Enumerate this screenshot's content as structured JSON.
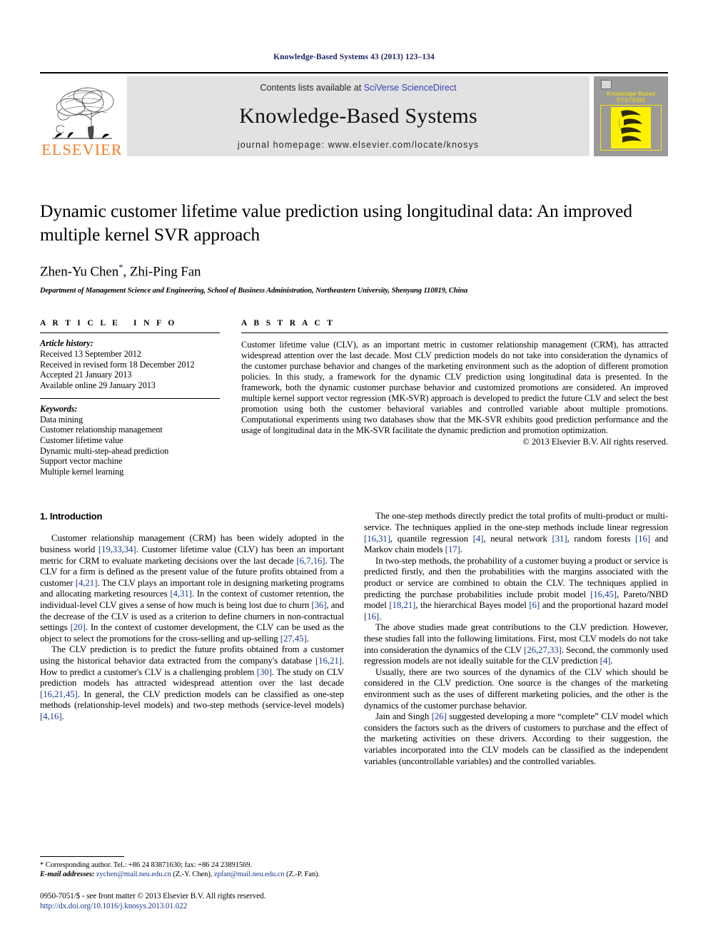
{
  "running_head": "Knowledge-Based Systems 43 (2013) 123–134",
  "masthead": {
    "publisher_name": "ELSEVIER",
    "contents_prefix": "Contents lists available at ",
    "contents_link": "SciVerse ScienceDirect",
    "journal_title": "Knowledge-Based Systems",
    "homepage_line": "journal homepage: www.elsevier.com/locate/knosys",
    "cover": {
      "line1": "Knowledge-Based",
      "line2": "SYSTEMS"
    },
    "link_color": "#3a3fb5"
  },
  "article": {
    "title": "Dynamic customer lifetime value prediction using longitudinal data: An improved multiple kernel SVR approach",
    "authors": "Zhen-Yu Chen",
    "corresponding_marker": "*",
    "authors_rest": ", Zhi-Ping Fan",
    "affiliation": "Department of Management Science and Engineering, School of Business Administration, Northeastern University, Shenyang 110819, China"
  },
  "article_info": {
    "heading": "ARTICLE INFO",
    "history_label": "Article history:",
    "history": [
      "Received 13 September 2012",
      "Received in revised form 18 December 2012",
      "Accepted 21 January 2013",
      "Available online 29 January 2013"
    ],
    "keywords_label": "Keywords:",
    "keywords": [
      "Data mining",
      "Customer relationship management",
      "Customer lifetime value",
      "Dynamic multi-step-ahead prediction",
      "Support vector machine",
      "Multiple kernel learning"
    ]
  },
  "abstract": {
    "heading": "ABSTRACT",
    "text": "Customer lifetime value (CLV), as an important metric in customer relationship management (CRM), has attracted widespread attention over the last decade. Most CLV prediction models do not take into consideration the dynamics of the customer purchase behavior and changes of the marketing environment such as the adoption of different promotion policies. In this study, a framework for the dynamic CLV prediction using longitudinal data is presented. In the framework, both the dynamic customer purchase behavior and customized promotions are considered. An improved multiple kernel support vector regression (MK-SVR) approach is developed to predict the future CLV and select the best promotion using both the customer behavioral variables and controlled variable about multiple promotions. Computational experiments using two databases show that the MK-SVR exhibits good prediction performance and the usage of longitudinal data in the MK-SVR facilitate the dynamic prediction and promotion optimization.",
    "copyright": "© 2013 Elsevier B.V. All rights reserved."
  },
  "body": {
    "section_title": "1. Introduction",
    "left_paragraphs": [
      "Customer relationship management (CRM) has been widely adopted in the business world [19,33,34]. Customer lifetime value (CLV) has been an important metric for CRM to evaluate marketing decisions over the last decade [6,7,16]. The CLV for a firm is defined as the present value of the future profits obtained from a customer [4,21]. The CLV plays an important role in designing marketing programs and allocating marketing resources [4,31]. In the context of customer retention, the individual-level CLV gives a sense of how much is being lost due to churn [36], and the decrease of the CLV is used as a criterion to define churners in non-contractual settings [20]. In the context of customer development, the CLV can be used as the object to select the promotions for the cross-selling and up-selling [27,45].",
      "The CLV prediction is to predict the future profits obtained from a customer using the historical behavior data extracted from the company's database [16,21]. How to predict a customer's CLV is a challenging problem [30]. The study on CLV prediction models has attracted widespread attention over the last decade [16,21,45]. In general, the CLV prediction models can be classified as one-step methods (relationship-level models) and two-step methods (service-level models) [4,16]."
    ],
    "right_paragraphs": [
      "The one-step methods directly predict the total profits of multi-product or multi-service. The techniques applied in the one-step methods include linear regression [16,31], quantile regression [4], neural network [31], random forests [16] and Markov chain models [17].",
      "In two-step methods, the probability of a customer buying a product or service is predicted firstly, and then the probabilities with the margins associated with the product or service are combined to obtain the CLV. The techniques applied in predicting the purchase probabilities include probit model [16,45], Pareto/NBD model [18,21], the hierarchical Bayes model [6] and the proportional hazard model [16].",
      "The above studies made great contributions to the CLV prediction. However, these studies fall into the following limitations. First, most CLV models do not take into consideration the dynamics of the CLV [26,27,33]. Second, the commonly used regression models are not ideally suitable for the CLV prediction [4].",
      "Usually, there are two sources of the dynamics of the CLV which should be considered in the CLV prediction. One source is the changes of the marketing environment such as the uses of different marketing policies, and the other is the dynamics of the customer purchase behavior.",
      "Jain and Singh [26] suggested developing a more “complete” CLV model which considers the factors such as the drivers of customers to purchase and the effect of the marketing activities on these drivers. According to their suggestion, the variables incorporated into the CLV models can be classified as the independent variables (uncontrollable variables) and the controlled variables."
    ]
  },
  "footnotes": {
    "corresponding": "* Corresponding author. Tel.: +86 24 83871630; fax: +86 24 23891569.",
    "email_label": "E-mail addresses:",
    "email_1": "zychen@mail.neu.edu.cn",
    "email_1_name": " (Z.-Y. Chen), ",
    "email_2": "zpfan@mail.neu.edu.cn",
    "email_2_name": " (Z.-P. Fan).",
    "imprint": "0950-7051/$ - see front matter © 2013 Elsevier B.V. All rights reserved.",
    "doi": "http://dx.doi.org/10.1016/j.knosys.2013.01.022"
  }
}
